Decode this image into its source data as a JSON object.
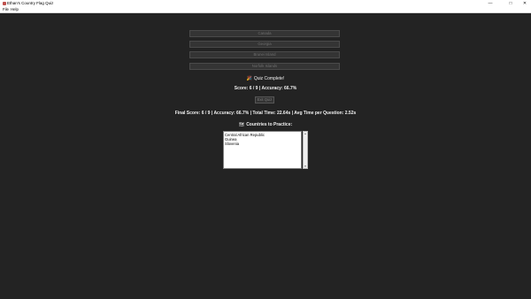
{
  "window": {
    "title": "Ethan's Country Flag Quiz",
    "controls": {
      "minimize": "—",
      "maximize": "□",
      "close": "✕"
    }
  },
  "menu": [
    "File",
    "Help"
  ],
  "options": [
    "Canada",
    "Georgia",
    "Brunei Island",
    "Norfolk Islands"
  ],
  "status": {
    "emoji": "🎉",
    "text": "Quiz Complete!"
  },
  "score_line": "Score: 6 / 9  |  Accuracy: 66.7%",
  "exit_button": "Exit Quiz",
  "final_line": "Final Score: 6 / 9  |  Accuracy: 66.7%  |  Total Time: 22.64s  |  Avg Time per Question: 2.52s",
  "practice": {
    "emoji": "🗺",
    "heading": "Countries to Practice:",
    "items": [
      "Central African Republic",
      "Guinea",
      "Slovenia"
    ]
  }
}
